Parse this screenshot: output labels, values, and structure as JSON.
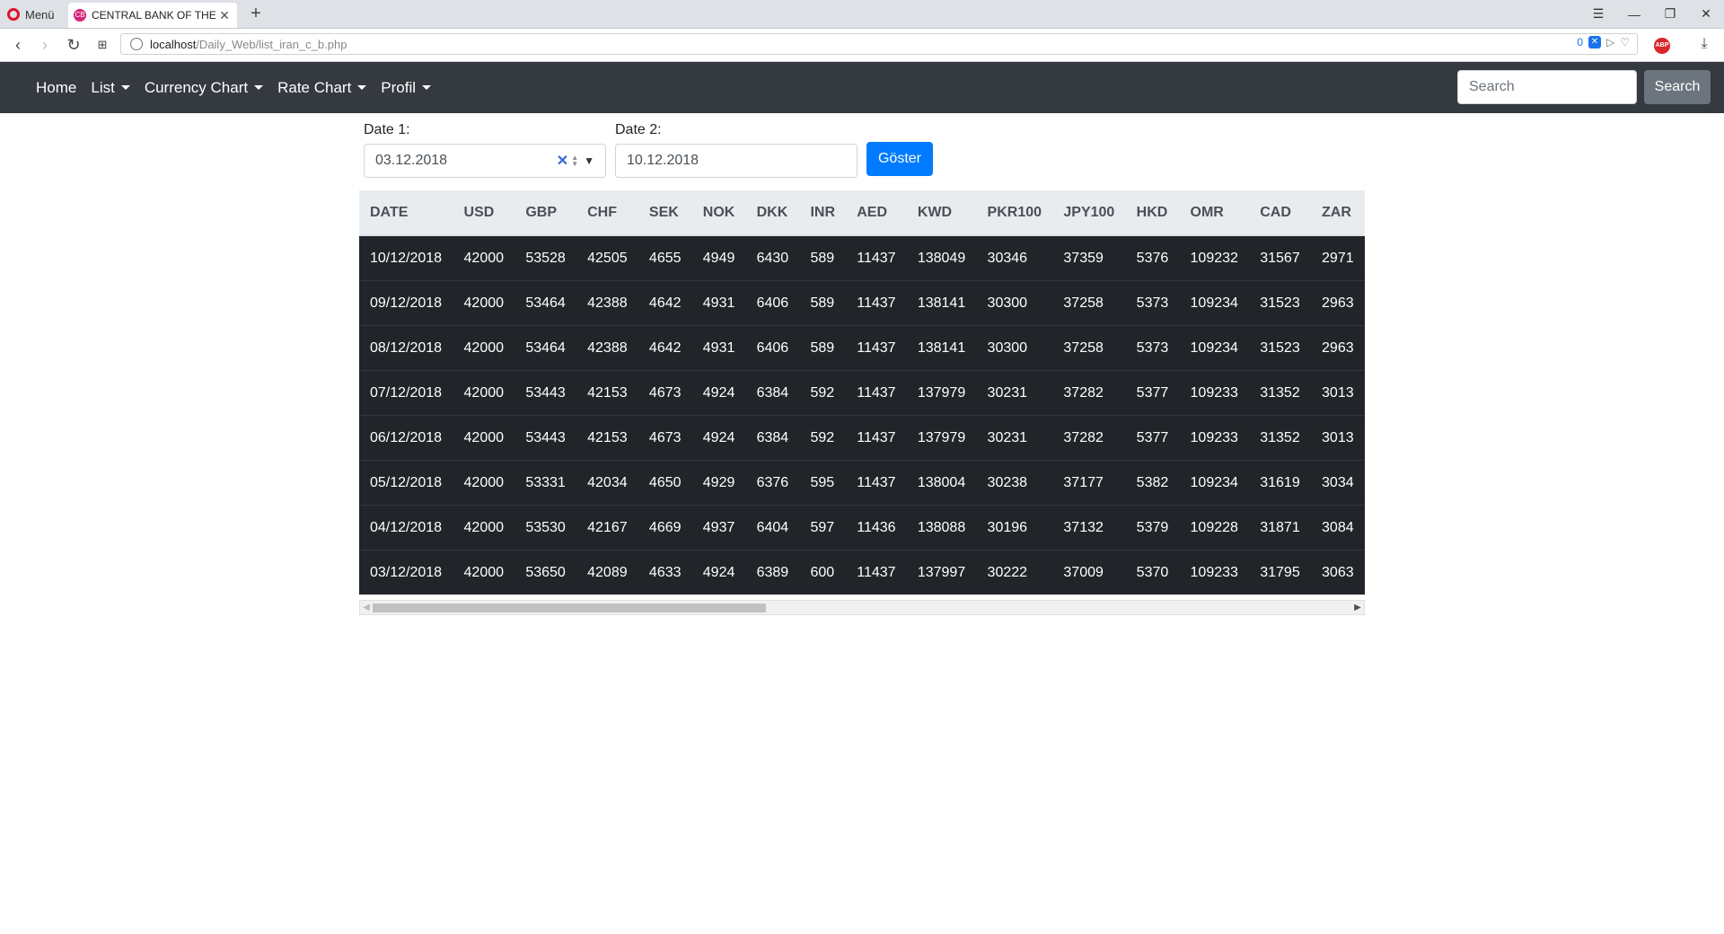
{
  "browser": {
    "menu_label": "Menü",
    "tab_title": "CENTRAL BANK OF THE IS",
    "tab_favicon_text": "CB",
    "url_host": "localhost",
    "url_path": "/Daily_Web/list_iran_c_b.php",
    "tracker_count": "0",
    "abp_label": "ABP"
  },
  "navbar": {
    "items": [
      {
        "label": "Home",
        "dropdown": false
      },
      {
        "label": "List",
        "dropdown": true
      },
      {
        "label": "Currency Chart",
        "dropdown": true
      },
      {
        "label": "Rate Chart",
        "dropdown": true
      },
      {
        "label": "Profil",
        "dropdown": true
      }
    ],
    "search_placeholder": "Search",
    "search_button": "Search"
  },
  "form": {
    "date1_label": "Date 1:",
    "date1_value": "03.12.2018",
    "date2_label": "Date 2:",
    "date2_value": "10.12.2018",
    "submit_label": "Göster"
  },
  "table": {
    "columns": [
      "DATE",
      "USD",
      "GBP",
      "CHF",
      "SEK",
      "NOK",
      "DKK",
      "INR",
      "AED",
      "KWD",
      "PKR100",
      "JPY100",
      "HKD",
      "OMR",
      "CAD",
      "ZAR"
    ],
    "rows": [
      [
        "10/12/2018",
        "42000",
        "53528",
        "42505",
        "4655",
        "4949",
        "6430",
        "589",
        "11437",
        "138049",
        "30346",
        "37359",
        "5376",
        "109232",
        "31567",
        "2971"
      ],
      [
        "09/12/2018",
        "42000",
        "53464",
        "42388",
        "4642",
        "4931",
        "6406",
        "589",
        "11437",
        "138141",
        "30300",
        "37258",
        "5373",
        "109234",
        "31523",
        "2963"
      ],
      [
        "08/12/2018",
        "42000",
        "53464",
        "42388",
        "4642",
        "4931",
        "6406",
        "589",
        "11437",
        "138141",
        "30300",
        "37258",
        "5373",
        "109234",
        "31523",
        "2963"
      ],
      [
        "07/12/2018",
        "42000",
        "53443",
        "42153",
        "4673",
        "4924",
        "6384",
        "592",
        "11437",
        "137979",
        "30231",
        "37282",
        "5377",
        "109233",
        "31352",
        "3013"
      ],
      [
        "06/12/2018",
        "42000",
        "53443",
        "42153",
        "4673",
        "4924",
        "6384",
        "592",
        "11437",
        "137979",
        "30231",
        "37282",
        "5377",
        "109233",
        "31352",
        "3013"
      ],
      [
        "05/12/2018",
        "42000",
        "53331",
        "42034",
        "4650",
        "4929",
        "6376",
        "595",
        "11437",
        "138004",
        "30238",
        "37177",
        "5382",
        "109234",
        "31619",
        "3034"
      ],
      [
        "04/12/2018",
        "42000",
        "53530",
        "42167",
        "4669",
        "4937",
        "6404",
        "597",
        "11436",
        "138088",
        "30196",
        "37132",
        "5379",
        "109228",
        "31871",
        "3084"
      ],
      [
        "03/12/2018",
        "42000",
        "53650",
        "42089",
        "4633",
        "4924",
        "6389",
        "600",
        "11437",
        "137997",
        "30222",
        "37009",
        "5370",
        "109233",
        "31795",
        "3063"
      ]
    ]
  },
  "colors": {
    "navbar_bg": "#343a40",
    "primary": "#007bff",
    "secondary": "#6c757d",
    "table_dark": "#212529",
    "table_head": "#e9ecef"
  }
}
